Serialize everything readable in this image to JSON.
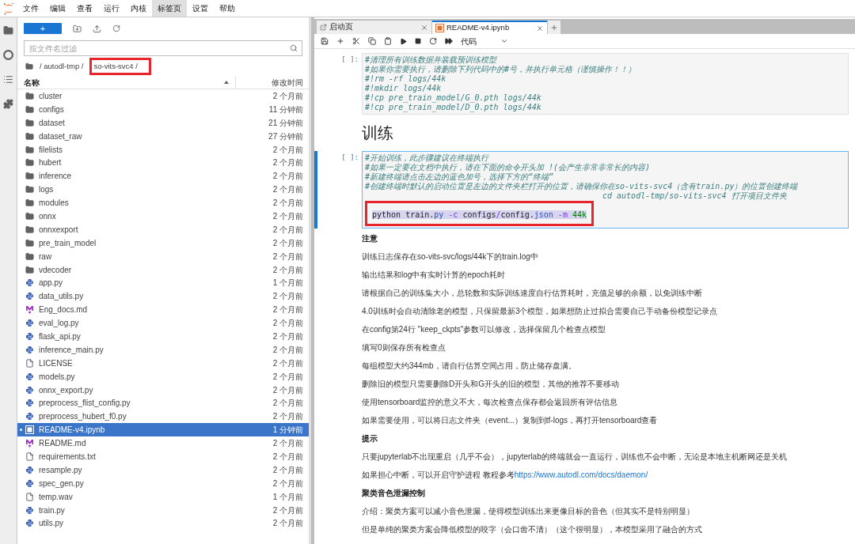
{
  "menu": [
    {
      "label": "文件",
      "selected": false
    },
    {
      "label": "编辑",
      "selected": false
    },
    {
      "label": "查看",
      "selected": false
    },
    {
      "label": "运行",
      "selected": false
    },
    {
      "label": "内核",
      "selected": false
    },
    {
      "label": "标签页",
      "selected": true
    },
    {
      "label": "设置",
      "selected": false
    },
    {
      "label": "帮助",
      "selected": false
    }
  ],
  "file_browser": {
    "new_button": "+",
    "filter": {
      "placeholder": "按文件名过滤"
    },
    "breadcrumb": [
      {
        "text": "/ autodl-tmp /",
        "annotated": false
      },
      {
        "text": "so-vits-svc4 /",
        "annotated": true
      }
    ],
    "columns": [
      "名称",
      "修改时间"
    ],
    "files": [
      {
        "name": "cluster",
        "modified": "2 个月前",
        "kind": "folder",
        "selected": false,
        "open": false
      },
      {
        "name": "configs",
        "modified": "11 分钟前",
        "kind": "folder",
        "selected": false,
        "open": false
      },
      {
        "name": "dataset",
        "modified": "21 分钟前",
        "kind": "folder",
        "selected": false,
        "open": false
      },
      {
        "name": "dataset_raw",
        "modified": "27 分钟前",
        "kind": "folder",
        "selected": false,
        "open": false
      },
      {
        "name": "filelists",
        "modified": "2 个月前",
        "kind": "folder",
        "selected": false,
        "open": false
      },
      {
        "name": "hubert",
        "modified": "2 个月前",
        "kind": "folder",
        "selected": false,
        "open": false
      },
      {
        "name": "inference",
        "modified": "2 个月前",
        "kind": "folder",
        "selected": false,
        "open": false
      },
      {
        "name": "logs",
        "modified": "2 个月前",
        "kind": "folder",
        "selected": false,
        "open": false
      },
      {
        "name": "modules",
        "modified": "2 个月前",
        "kind": "folder",
        "selected": false,
        "open": false
      },
      {
        "name": "onnx",
        "modified": "2 个月前",
        "kind": "folder",
        "selected": false,
        "open": false
      },
      {
        "name": "onnxexport",
        "modified": "2 个月前",
        "kind": "folder",
        "selected": false,
        "open": false
      },
      {
        "name": "pre_train_model",
        "modified": "2 个月前",
        "kind": "folder",
        "selected": false,
        "open": false
      },
      {
        "name": "raw",
        "modified": "2 个月前",
        "kind": "folder",
        "selected": false,
        "open": false
      },
      {
        "name": "vdecoder",
        "modified": "2 个月前",
        "kind": "folder",
        "selected": false,
        "open": false
      },
      {
        "name": "app.py",
        "modified": "1 个月前",
        "kind": "python",
        "selected": false,
        "open": false
      },
      {
        "name": "data_utils.py",
        "modified": "2 个月前",
        "kind": "python",
        "selected": false,
        "open": false
      },
      {
        "name": "Eng_docs.md",
        "modified": "2 个月前",
        "kind": "markdown",
        "selected": false,
        "open": false
      },
      {
        "name": "eval_log.py",
        "modified": "2 个月前",
        "kind": "python",
        "selected": false,
        "open": false
      },
      {
        "name": "flask_api.py",
        "modified": "2 个月前",
        "kind": "python",
        "selected": false,
        "open": false
      },
      {
        "name": "inference_main.py",
        "modified": "2 个月前",
        "kind": "python",
        "selected": false,
        "open": false
      },
      {
        "name": "LICENSE",
        "modified": "2 个月前",
        "kind": "file",
        "selected": false,
        "open": false
      },
      {
        "name": "models.py",
        "modified": "2 个月前",
        "kind": "python",
        "selected": false,
        "open": false
      },
      {
        "name": "onnx_export.py",
        "modified": "2 个月前",
        "kind": "python",
        "selected": false,
        "open": false
      },
      {
        "name": "preprocess_flist_config.py",
        "modified": "2 个月前",
        "kind": "python",
        "selected": false,
        "open": false
      },
      {
        "name": "preprocess_hubert_f0.py",
        "modified": "2 个月前",
        "kind": "python",
        "selected": false,
        "open": false
      },
      {
        "name": "README-v4.ipynb",
        "modified": "1 分钟前",
        "kind": "notebook",
        "selected": true,
        "open": true
      },
      {
        "name": "README.md",
        "modified": "2 个月前",
        "kind": "markdown",
        "selected": false,
        "open": false
      },
      {
        "name": "requirements.txt",
        "modified": "2 个月前",
        "kind": "file",
        "selected": false,
        "open": false
      },
      {
        "name": "resample.py",
        "modified": "2 个月前",
        "kind": "python",
        "selected": false,
        "open": false
      },
      {
        "name": "spec_gen.py",
        "modified": "2 个月前",
        "kind": "python",
        "selected": false,
        "open": false
      },
      {
        "name": "temp.wav",
        "modified": "1 个月前",
        "kind": "file",
        "selected": false,
        "open": false
      },
      {
        "name": "train.py",
        "modified": "2 个月前",
        "kind": "python",
        "selected": false,
        "open": false
      },
      {
        "name": "utils.py",
        "modified": "2 个月前",
        "kind": "python",
        "selected": false,
        "open": false
      }
    ]
  },
  "notebook": {
    "tabs": [
      {
        "label": "启动页",
        "kind": "launcher",
        "selected": false
      },
      {
        "label": "README-v4.ipynb",
        "kind": "notebook",
        "selected": true
      }
    ],
    "cell_type": "代码",
    "cells": [
      {
        "kind": "code",
        "prompt": "[ ]:",
        "active": false,
        "comments": [
          "#清理所有训练数据并装载预训练模型",
          "#如果你需要执行，请删除下列代码中的#号，并执行单元格（谨慎操作！！）",
          "#!rm -rf logs/44k",
          "#!mkdir logs/44k",
          "#!cp pre_train_model/G_0.pth logs/44k",
          "#!cp pre_train_model/D_0.pth logs/44k"
        ]
      },
      {
        "kind": "heading",
        "text": "训练"
      },
      {
        "kind": "code",
        "prompt": "[ ]:",
        "active": true,
        "comments": [
          "#开始训练，此步骤建议在终端执行",
          "#如果一定要在文档中执行，请在下面的命令开头加 !(会产生非常非常长的内容)",
          "#新建终端请点击左边的蓝色加号，选择下方的“终端”",
          "#创建终端时默认的启动位置是左边的文件夹栏打开的位置，请确保你在so-vits-svc4（含有train.py）的位置创建终端"
        ],
        "comment_tail": "cd autodl-tmp/so-vits-svc4 打开项目文件夹",
        "command": {
          "selected": true,
          "annotated": true,
          "tokens": [
            {
              "text": "python train.",
              "kind": "plain"
            },
            {
              "text": "py",
              "kind": "attr"
            },
            {
              "text": " -c",
              "kind": "op"
            },
            {
              "text": " configs",
              "kind": "plain"
            },
            {
              "text": "/",
              "kind": "op"
            },
            {
              "text": "config.",
              "kind": "plain"
            },
            {
              "text": "json",
              "kind": "attr"
            },
            {
              "text": " -m",
              "kind": "op"
            },
            {
              "text": " 44k",
              "kind": "num"
            }
          ]
        }
      },
      {
        "kind": "subheading",
        "text": "注意"
      },
      {
        "kind": "paragraph",
        "text": "训练日志保存在so-vits-svc/logs/44k下的train.log中"
      },
      {
        "kind": "paragraph",
        "text": "输出结果和log中有实时计算的epoch耗时"
      },
      {
        "kind": "paragraph",
        "text": "请根据自己的训练集大小，总轮数和实际训练速度自行估算耗时，充值足够的余额，以免训练中断"
      },
      {
        "kind": "paragraph",
        "text": "4.0训练时会自动清除老的模型，只保留最新3个模型，如果想防止过拟合需要自己手动备份模型记录点"
      },
      {
        "kind": "paragraph",
        "text": "在config第24行 \"keep_ckpts\"参数可以修改，选择保留几个检查点模型"
      },
      {
        "kind": "paragraph",
        "text": "填写0则保存所有检查点"
      },
      {
        "kind": "paragraph",
        "text": "每组模型大约344mb，请自行估算空间占用，防止储存盘满。"
      },
      {
        "kind": "paragraph",
        "text": "删除旧的模型只需要删除D开头和G开头的旧的模型，其他的推荐不要移动"
      },
      {
        "kind": "paragraph",
        "text": "使用tensorboard监控的意义不大，每次检查点保存都会返回所有评估信息"
      },
      {
        "kind": "paragraph",
        "text": "如果需要使用，可以将日志文件夹（event...）复制到tf-logs，再打开tensorboard查看"
      },
      {
        "kind": "subheading",
        "text": "提示"
      },
      {
        "kind": "paragraph",
        "text": "只要jupyterlab不出现重启（几乎不会），jupyterlab的终端就会一直运行，训练也不会中断，无论是本地主机断网还是关机"
      },
      {
        "kind": "link_paragraph",
        "text": "如果担心中断，可以开启守护进程 教程参考",
        "link": "https://www.autodl.com/docs/daemon/"
      },
      {
        "kind": "subheading",
        "text": "聚类音色泄漏控制"
      },
      {
        "kind": "paragraph",
        "text": "介绍：聚类方案可以减小音色泄漏，使得模型训练出来更像目标的音色（但其实不是特别明显）"
      },
      {
        "kind": "paragraph",
        "text": "但是单纯的聚类方案会降低模型的咬字（会口齿不清）（这个很明显），本模型采用了融合的方式"
      }
    ]
  }
}
